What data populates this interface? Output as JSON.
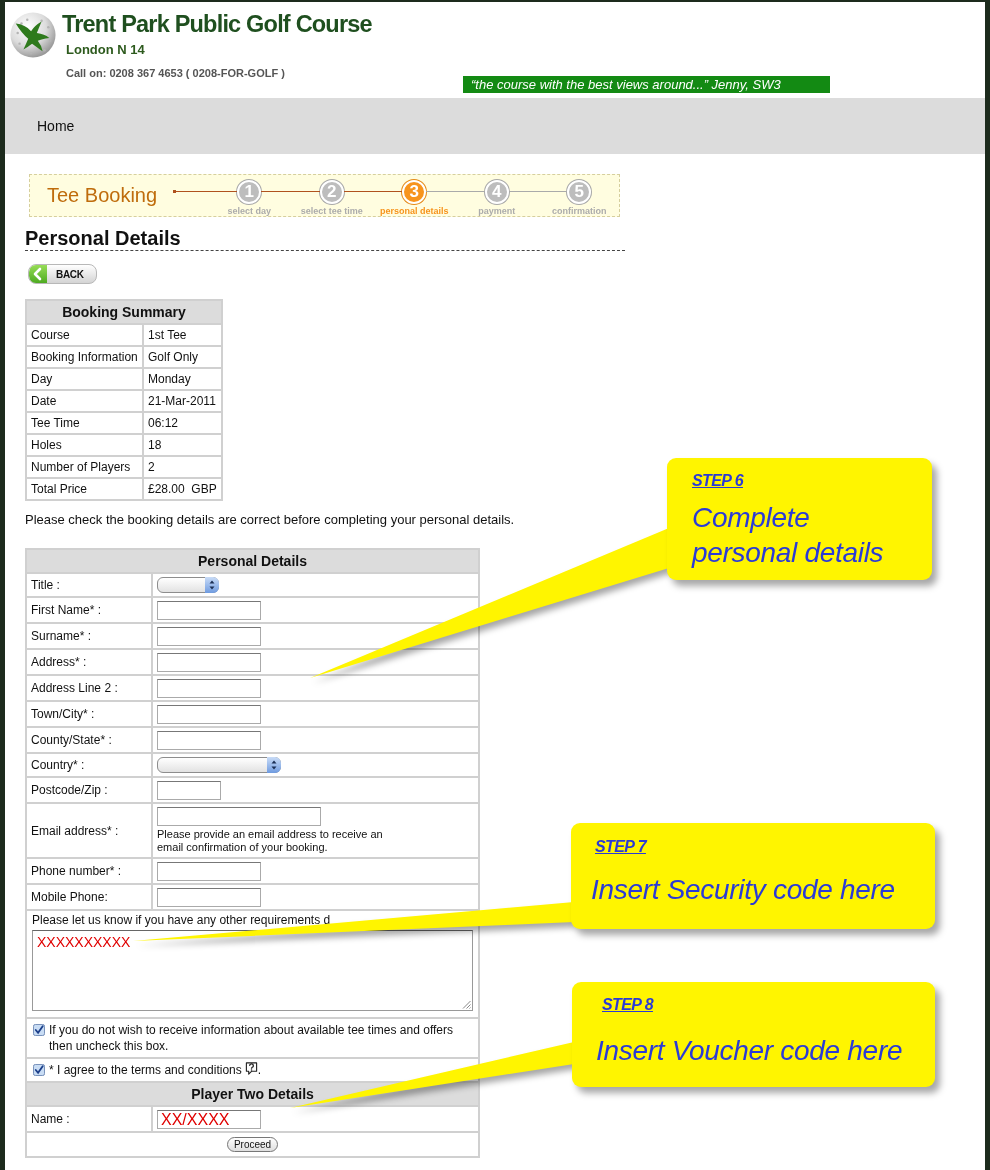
{
  "header": {
    "title": "Trent Park Public Golf Course",
    "location": "London N 14",
    "phone": "Call on: 0208 367 4653 ( 0208-FOR-GOLF )",
    "quote": "“the course with the best views around...” Jenny, SW3"
  },
  "nav": [
    {
      "label": "Home"
    }
  ],
  "booking_steps": {
    "title": "Tee Booking",
    "steps": [
      {
        "number": "1",
        "label": "select day",
        "selected": false
      },
      {
        "number": "2",
        "label": "select tee time",
        "selected": false
      },
      {
        "number": "3",
        "label": "personal details",
        "selected": true
      },
      {
        "number": "4",
        "label": "payment",
        "selected": false
      },
      {
        "number": "5",
        "label": "confirmation",
        "selected": false
      }
    ]
  },
  "page_heading": "Personal Details",
  "back_button": "BACK",
  "booking_summary": {
    "title": "Booking Summary",
    "rows": [
      {
        "label": "Course",
        "value": "1st Tee"
      },
      {
        "label": "Booking Information",
        "value": "Golf Only"
      },
      {
        "label": "Day",
        "value": "Monday"
      },
      {
        "label": "Date",
        "value": "21-Mar-2011"
      },
      {
        "label": "Tee Time",
        "value": "06:12"
      },
      {
        "label": "Holes",
        "value": "18"
      },
      {
        "label": "Number of Players",
        "value": "2"
      },
      {
        "label": "Total Price",
        "value": "£28.00  GBP"
      }
    ]
  },
  "notice": "Please check the booking details are correct before completing your personal details.",
  "personal_details": {
    "title": "Personal Details",
    "fields": [
      {
        "kind": "select",
        "label": "Title :"
      },
      {
        "kind": "text",
        "label": "First Name* :"
      },
      {
        "kind": "text",
        "label": "Surname* :"
      },
      {
        "kind": "text",
        "label": "Address* :"
      },
      {
        "kind": "text",
        "label": "Address Line 2 :"
      },
      {
        "kind": "text",
        "label": "Town/City* :"
      },
      {
        "kind": "text",
        "label": "County/State* :"
      },
      {
        "kind": "select",
        "label": "Country* :"
      },
      {
        "kind": "text",
        "label": "Postcode/Zip :"
      },
      {
        "kind": "email",
        "label": "Email address* :",
        "hint": "Please provide an email address to receive an email confirmation of your booking."
      },
      {
        "kind": "text",
        "label": "Phone number* :"
      },
      {
        "kind": "text",
        "label": "Mobile Phone:"
      }
    ],
    "requirements": {
      "label": "Please let us know if you have any other requirements d",
      "value": "XXXXXXXXXX"
    },
    "options": [
      {
        "label": "If you do not wish to receive information about available tee times and offers then uncheck this box.",
        "checked": true,
        "help": false
      },
      {
        "label": "* I agree to the terms and conditions",
        "suffix": ".",
        "checked": true,
        "help": true
      }
    ]
  },
  "player_two": {
    "title": "Player Two Details",
    "fields": [
      {
        "label": "Name :",
        "value": "XX/XXXX"
      }
    ]
  },
  "proceed_button": "Proceed",
  "callouts": [
    {
      "step": "STEP 6",
      "text": "Complete personal details"
    },
    {
      "step": "STEP 7",
      "text": "Insert Security code here"
    },
    {
      "step": "STEP 8",
      "text": "Insert Voucher code here"
    }
  ]
}
